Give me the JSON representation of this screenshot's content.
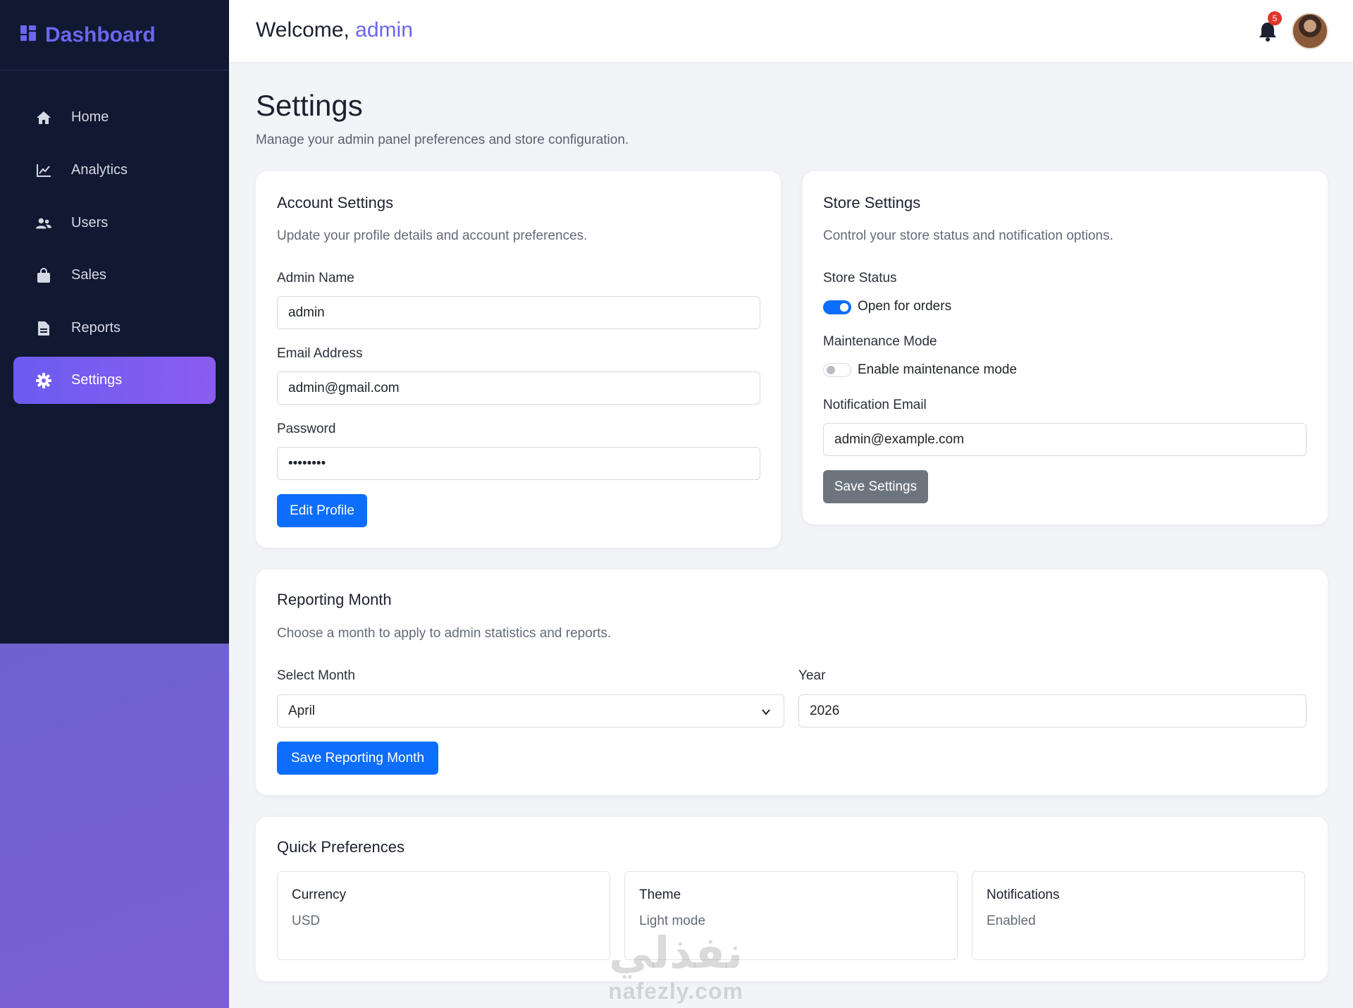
{
  "sidebar": {
    "brand": "Dashboard",
    "items": [
      {
        "label": "Home",
        "icon": "home-icon"
      },
      {
        "label": "Analytics",
        "icon": "chart-line-icon"
      },
      {
        "label": "Users",
        "icon": "users-icon"
      },
      {
        "label": "Sales",
        "icon": "shopping-bag-icon"
      },
      {
        "label": "Reports",
        "icon": "file-icon"
      },
      {
        "label": "Settings",
        "icon": "gear-icon",
        "active": true
      }
    ]
  },
  "header": {
    "welcome": "Welcome,",
    "username": "admin",
    "notification_count": "5"
  },
  "page": {
    "title": "Settings",
    "subtitle": "Manage your admin panel preferences and store configuration."
  },
  "account": {
    "title": "Account Settings",
    "subtitle": "Update your profile details and account preferences.",
    "name_label": "Admin Name",
    "name_value": "admin",
    "email_label": "Email Address",
    "email_value": "admin@gmail.com",
    "password_label": "Password",
    "password_value": "••••••••",
    "edit_button": "Edit Profile"
  },
  "store": {
    "title": "Store Settings",
    "subtitle": "Control your store status and notification options.",
    "status_label": "Store Status",
    "status_toggle_label": "Open for orders",
    "status_on": true,
    "maintenance_label": "Maintenance Mode",
    "maintenance_toggle_label": "Enable maintenance mode",
    "maintenance_on": false,
    "notif_email_label": "Notification Email",
    "notif_email_value": "admin@example.com",
    "save_button": "Save Settings"
  },
  "reporting": {
    "title": "Reporting Month",
    "subtitle": "Choose a month to apply to admin statistics and reports.",
    "month_label": "Select Month",
    "month_value": "April",
    "year_label": "Year",
    "year_value": "2026",
    "save_button": "Save Reporting Month"
  },
  "preferences": {
    "title": "Quick Preferences",
    "items": [
      {
        "title": "Currency",
        "value": "USD"
      },
      {
        "title": "Theme",
        "value": "Light mode"
      },
      {
        "title": "Notifications",
        "value": "Enabled"
      }
    ]
  },
  "watermark": {
    "arabic": "نفذلي",
    "latin": "nafezly.com"
  },
  "colors": {
    "sidebar_bg": "#111831",
    "accent": "#6b66f0",
    "primary_button": "#0d6efd",
    "secondary_button": "#6c757d",
    "badge": "#e0352b"
  }
}
